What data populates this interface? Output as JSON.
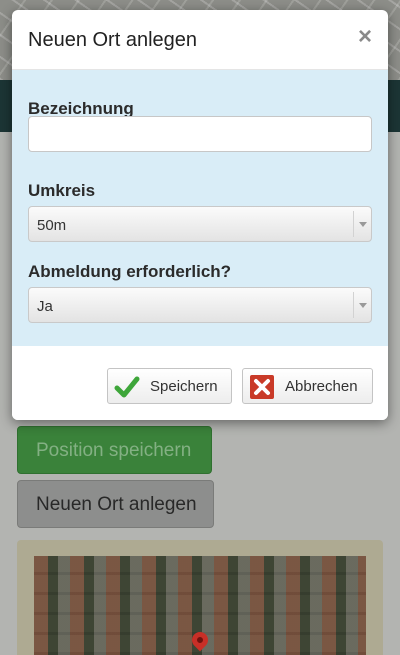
{
  "modal": {
    "title": "Neuen Ort anlegen",
    "close_symbol": "×",
    "fields": {
      "bezeichnung": {
        "label": "Bezeichnung",
        "value": "",
        "placeholder": ""
      },
      "umkreis": {
        "label": "Umkreis",
        "selected": "50m"
      },
      "abmeldung": {
        "label": "Abmeldung erforderlich?",
        "selected": "Ja"
      }
    },
    "buttons": {
      "save": {
        "label": "Speichern",
        "icon": "checkmark-icon"
      },
      "cancel": {
        "label": "Abbrechen",
        "icon": "cross-icon"
      }
    }
  },
  "background": {
    "position_button": "Position speichern",
    "new_place_button": "Neuen Ort anlegen"
  },
  "colors": {
    "body_bg": "#d9edf7",
    "save_check": "#3ea63a",
    "cancel_red": "#c93a28",
    "bg_green_button": "#3f8e3f"
  }
}
